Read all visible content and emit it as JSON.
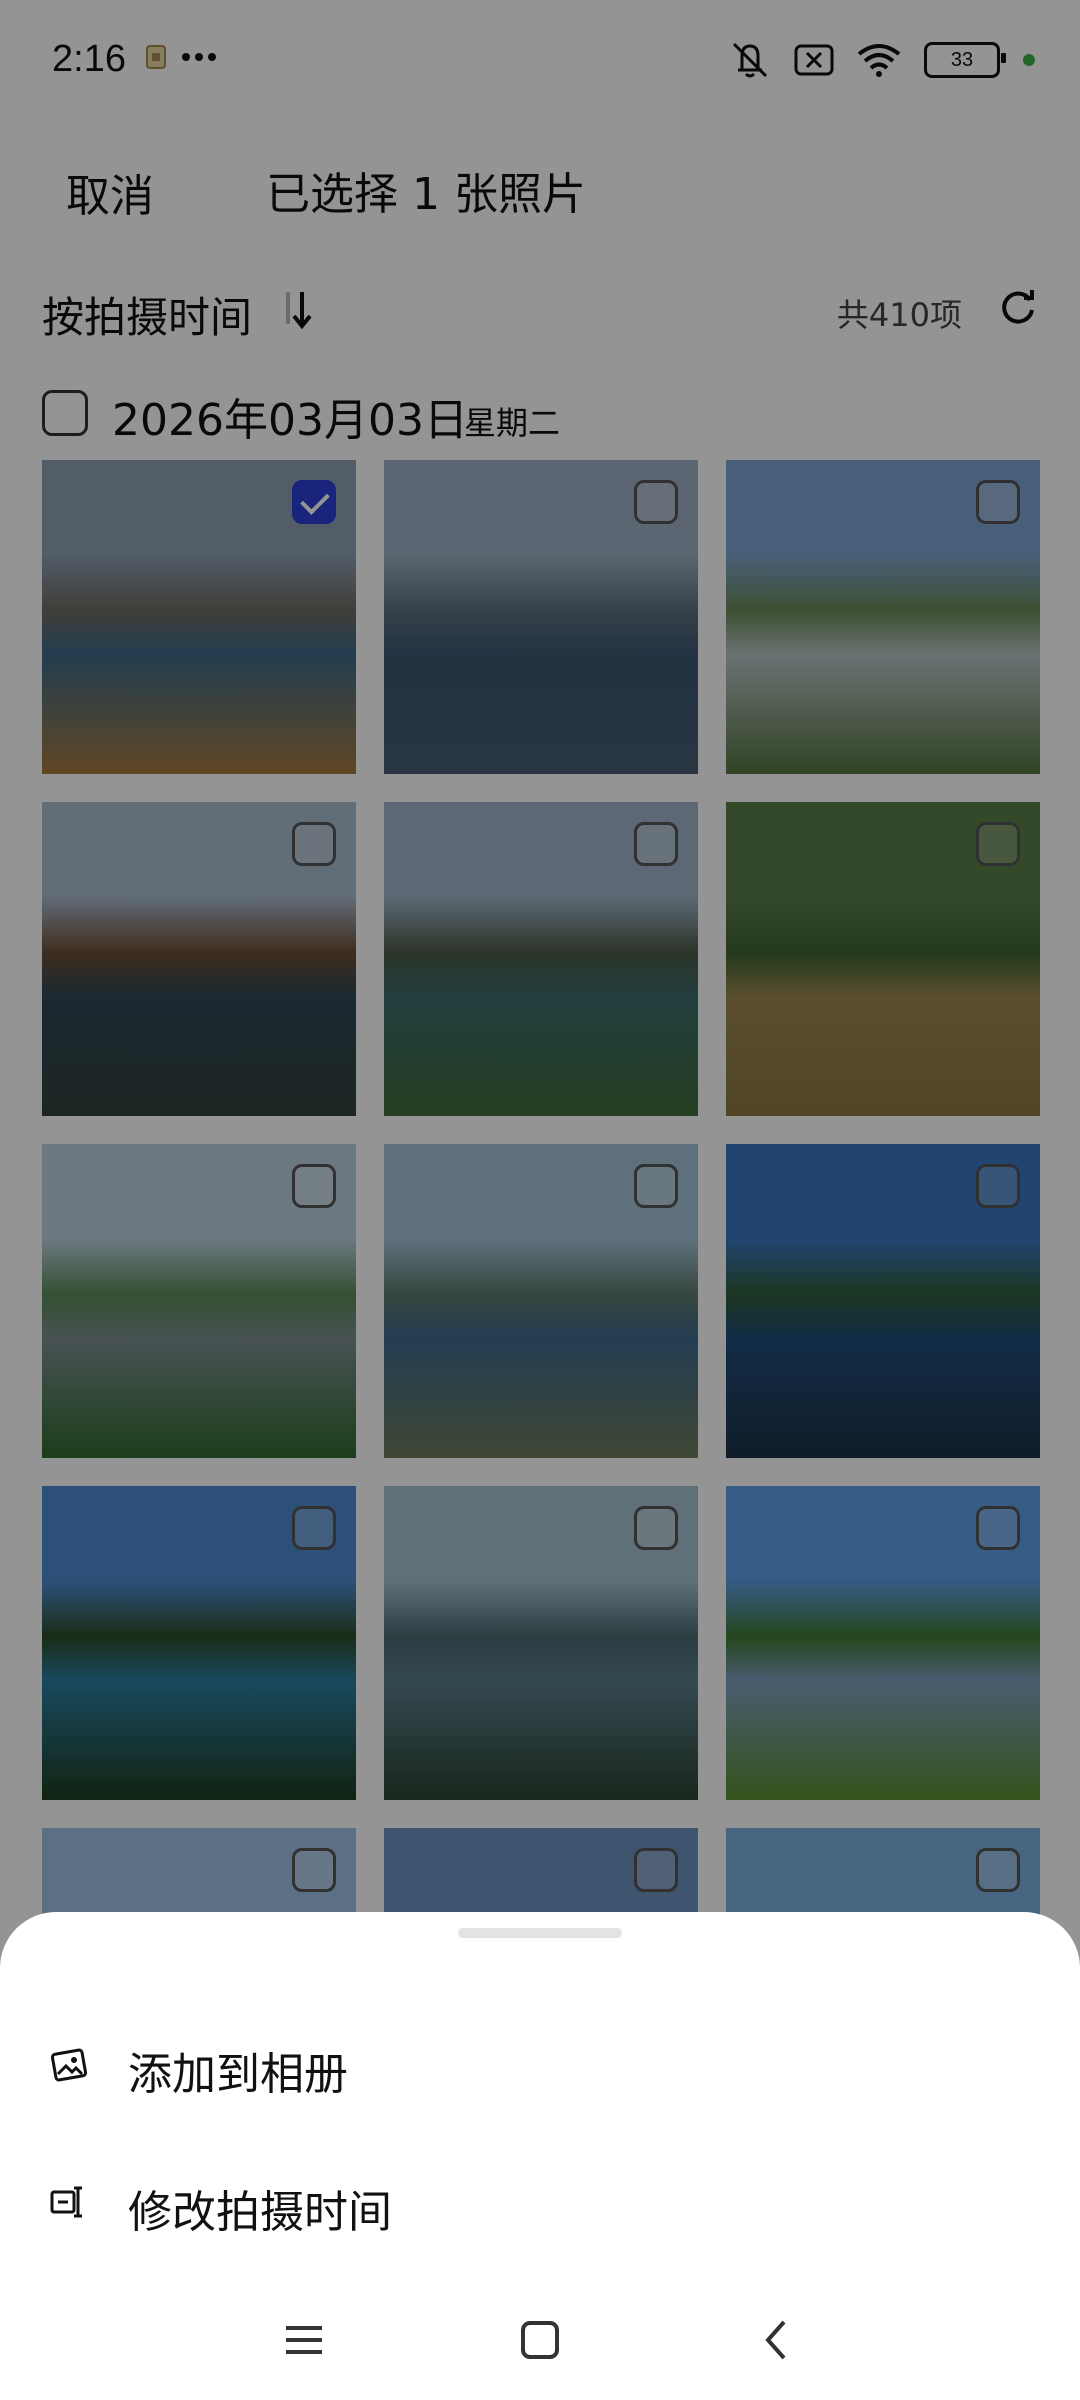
{
  "status": {
    "time": "2:16",
    "battery": "33",
    "icons": [
      "sim-card-icon",
      "more-dots-icon",
      "mute-icon",
      "no-sim-icon",
      "wifi-icon",
      "battery-icon",
      "charging-dot-icon"
    ]
  },
  "header": {
    "cancel_label": "取消",
    "title": "已选择 1 张照片"
  },
  "sort": {
    "label": "按拍摄时间",
    "count_label": "共410项",
    "sort_icon": "sort-descending-icon",
    "refresh_icon": "refresh-icon"
  },
  "group": {
    "date": "2026年03月03日",
    "weekday": "星期二",
    "selected": false
  },
  "photos": [
    {
      "id": "p1",
      "selected": true,
      "sky": "#8ea0b4",
      "mid": "#6f6b63",
      "ground": "#a57a3e",
      "water": "#3d6b8a"
    },
    {
      "id": "p2",
      "selected": false,
      "sky": "#9db0c4",
      "mid": "#5e6f80",
      "ground": "#475d72",
      "water": "#3d5873"
    },
    {
      "id": "p3",
      "selected": false,
      "sky": "#7fa4d0",
      "mid": "#6a8a57",
      "ground": "#567541",
      "water": "#b8c4c6"
    },
    {
      "id": "p4",
      "selected": false,
      "sky": "#a8bccd",
      "mid": "#6b4e37",
      "ground": "#33413d",
      "water": "#2f4754"
    },
    {
      "id": "p5",
      "selected": false,
      "sky": "#9fb6c9",
      "mid": "#4d5a48",
      "ground": "#3f6d3a",
      "water": "#3a6a6a"
    },
    {
      "id": "p6",
      "selected": false,
      "sky": "#5b7f48",
      "mid": "#3e6432",
      "ground": "#8b7740",
      "water": "#9b8751"
    },
    {
      "id": "p7",
      "selected": false,
      "sky": "#bcd0df",
      "mid": "#5c8a5a",
      "ground": "#2f6a2f",
      "water": "#7c8d8f"
    },
    {
      "id": "p8",
      "selected": false,
      "sky": "#a4c2d8",
      "mid": "#5e7b6d",
      "ground": "#6e7c5c",
      "water": "#3e6a8e"
    },
    {
      "id": "p9",
      "selected": false,
      "sky": "#3a77c2",
      "mid": "#2f5d3a",
      "ground": "#1d3347",
      "water": "#1f4c7a"
    },
    {
      "id": "p10",
      "selected": false,
      "sky": "#4e8bd1",
      "mid": "#2d4d2a",
      "ground": "#1f3d20",
      "water": "#2a7ea1"
    },
    {
      "id": "p11",
      "selected": false,
      "sky": "#a5c2cf",
      "mid": "#4c6b72",
      "ground": "#2a4230",
      "water": "#5d7e8c"
    },
    {
      "id": "p12",
      "selected": false,
      "sky": "#5d9de3",
      "mid": "#3f7a33",
      "ground": "#58902f",
      "water": "#7ea0c2"
    },
    {
      "id": "p13",
      "selected": false,
      "sky": "#9fc2e5",
      "mid": "#e8eef4",
      "ground": "#5d8a3a",
      "water": "#6f94c1"
    },
    {
      "id": "p14",
      "selected": false,
      "sky": "#6d93bf",
      "mid": "#3c4b3a",
      "ground": "#2f3e30",
      "water": "#4a6f93"
    },
    {
      "id": "p15",
      "selected": false,
      "sky": "#7daee0",
      "mid": "#e9eef3",
      "ground": "#b7c9d8",
      "water": "#8cb2d8"
    }
  ],
  "sheet": {
    "items": [
      {
        "label": "添加到相册",
        "icon": "add-to-album-icon"
      },
      {
        "label": "修改拍摄时间",
        "icon": "edit-time-icon"
      }
    ]
  },
  "nav": {
    "menu_icon": "menu-icon",
    "home_icon": "home-icon",
    "back_icon": "back-icon"
  }
}
